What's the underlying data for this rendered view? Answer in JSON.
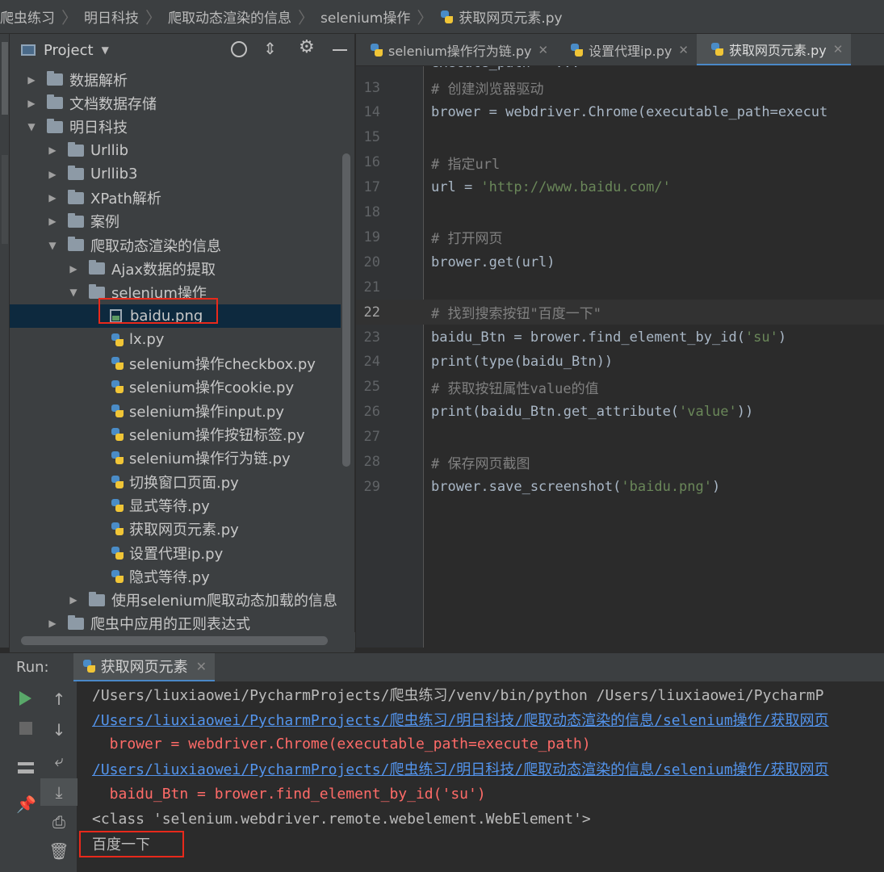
{
  "breadcrumb": [
    "爬虫练习",
    "明日科技",
    "爬取动态渲染的信息",
    "selenium操作",
    "获取网页元素.py"
  ],
  "project_panel": {
    "title": "Project",
    "icons": [
      "target-icon",
      "collapse-icon",
      "gear-icon",
      "minimize-icon"
    ]
  },
  "tree": [
    {
      "label": "数据解析",
      "type": "folder",
      "depth": 0,
      "expanded": false
    },
    {
      "label": "文档数据存储",
      "type": "folder",
      "depth": 0,
      "expanded": false
    },
    {
      "label": "明日科技",
      "type": "folder",
      "depth": 0,
      "expanded": true
    },
    {
      "label": "Urllib",
      "type": "folder",
      "depth": 1,
      "expanded": false
    },
    {
      "label": "Urllib3",
      "type": "folder",
      "depth": 1,
      "expanded": false
    },
    {
      "label": "XPath解析",
      "type": "folder",
      "depth": 1,
      "expanded": false
    },
    {
      "label": "案例",
      "type": "folder",
      "depth": 1,
      "expanded": false
    },
    {
      "label": "爬取动态渲染的信息",
      "type": "folder",
      "depth": 1,
      "expanded": true
    },
    {
      "label": "Ajax数据的提取",
      "type": "folder",
      "depth": 2,
      "expanded": false
    },
    {
      "label": "selenium操作",
      "type": "folder",
      "depth": 2,
      "expanded": true
    },
    {
      "label": "baidu.png",
      "type": "png",
      "depth": 3,
      "selected": true
    },
    {
      "label": "lx.py",
      "type": "py",
      "depth": 3
    },
    {
      "label": "selenium操作checkbox.py",
      "type": "py",
      "depth": 3
    },
    {
      "label": "selenium操作cookie.py",
      "type": "py",
      "depth": 3
    },
    {
      "label": "selenium操作input.py",
      "type": "py",
      "depth": 3
    },
    {
      "label": "selenium操作按钮标签.py",
      "type": "py",
      "depth": 3
    },
    {
      "label": "selenium操作行为链.py",
      "type": "py",
      "depth": 3
    },
    {
      "label": "切换窗口页面.py",
      "type": "py",
      "depth": 3
    },
    {
      "label": "显式等待.py",
      "type": "py",
      "depth": 3
    },
    {
      "label": "获取网页元素.py",
      "type": "py",
      "depth": 3
    },
    {
      "label": "设置代理ip.py",
      "type": "py",
      "depth": 3
    },
    {
      "label": "隐式等待.py",
      "type": "py",
      "depth": 3
    },
    {
      "label": "使用selenium爬取动态加载的信息",
      "type": "folder",
      "depth": 2,
      "expanded": false
    },
    {
      "label": "爬虫中应用的正则表达式",
      "type": "folder",
      "depth": 1,
      "expanded": false
    }
  ],
  "editor_tabs": [
    {
      "label": "selenium操作行为链.py",
      "active": false
    },
    {
      "label": "设置代理ip.py",
      "active": false
    },
    {
      "label": "获取网页元素.py",
      "active": true
    }
  ],
  "code_lines": [
    {
      "num": "13",
      "text": "# 创建浏览器驱动",
      "kind": "comment"
    },
    {
      "num": "14",
      "text": "brower = webdriver.Chrome(executable_path=execut",
      "kind": "code"
    },
    {
      "num": "15",
      "text": "",
      "kind": "code"
    },
    {
      "num": "16",
      "text": "# 指定url",
      "kind": "comment"
    },
    {
      "num": "17",
      "pre": "url = ",
      "str": "'http://www.baidu.com/'",
      "post": "",
      "kind": "mixed"
    },
    {
      "num": "18",
      "text": "",
      "kind": "code"
    },
    {
      "num": "19",
      "text": "# 打开网页",
      "kind": "comment"
    },
    {
      "num": "20",
      "text": "brower.get(url)",
      "kind": "code"
    },
    {
      "num": "21",
      "text": "",
      "kind": "code"
    },
    {
      "num": "22",
      "text": "# 找到搜索按钮\"百度一下\"",
      "kind": "comment",
      "current": true
    },
    {
      "num": "23",
      "pre": "baidu_Btn = brower.find_element_by_id(",
      "str": "'su'",
      "post": ")",
      "kind": "mixed"
    },
    {
      "num": "24",
      "text": "print(type(baidu_Btn))",
      "kind": "code"
    },
    {
      "num": "25",
      "text": "# 获取按钮属性value的值",
      "kind": "comment"
    },
    {
      "num": "26",
      "pre": "print(baidu_Btn.get_attribute(",
      "str": "'value'",
      "post": "))",
      "kind": "mixed"
    },
    {
      "num": "27",
      "text": "",
      "kind": "code"
    },
    {
      "num": "28",
      "text": "# 保存网页截图",
      "kind": "comment"
    },
    {
      "num": "29",
      "pre": "brower.save_screenshot(",
      "str": "'baidu.png'",
      "post": ")",
      "kind": "mixed"
    }
  ],
  "run": {
    "label": "Run:",
    "tab": "获取网页元素",
    "console": [
      {
        "text": "/Users/liuxiaowei/PycharmProjects/爬虫练习/venv/bin/python /Users/liuxiaowei/PycharmP",
        "kind": "out"
      },
      {
        "text": "/Users/liuxiaowei/PycharmProjects/爬虫练习/明日科技/爬取动态渲染的信息/selenium操作/获取网页",
        "kind": "link"
      },
      {
        "text": "  brower = webdriver.Chrome(executable_path=execute_path)",
        "kind": "err"
      },
      {
        "text": "/Users/liuxiaowei/PycharmProjects/爬虫练习/明日科技/爬取动态渲染的信息/selenium操作/获取网页",
        "kind": "link"
      },
      {
        "text": "  baidu_Btn = brower.find_element_by_id('su')",
        "kind": "err"
      },
      {
        "text": "<class 'selenium.webdriver.remote.webelement.WebElement'>",
        "kind": "out"
      },
      {
        "text": "百度一下",
        "kind": "out"
      }
    ]
  }
}
